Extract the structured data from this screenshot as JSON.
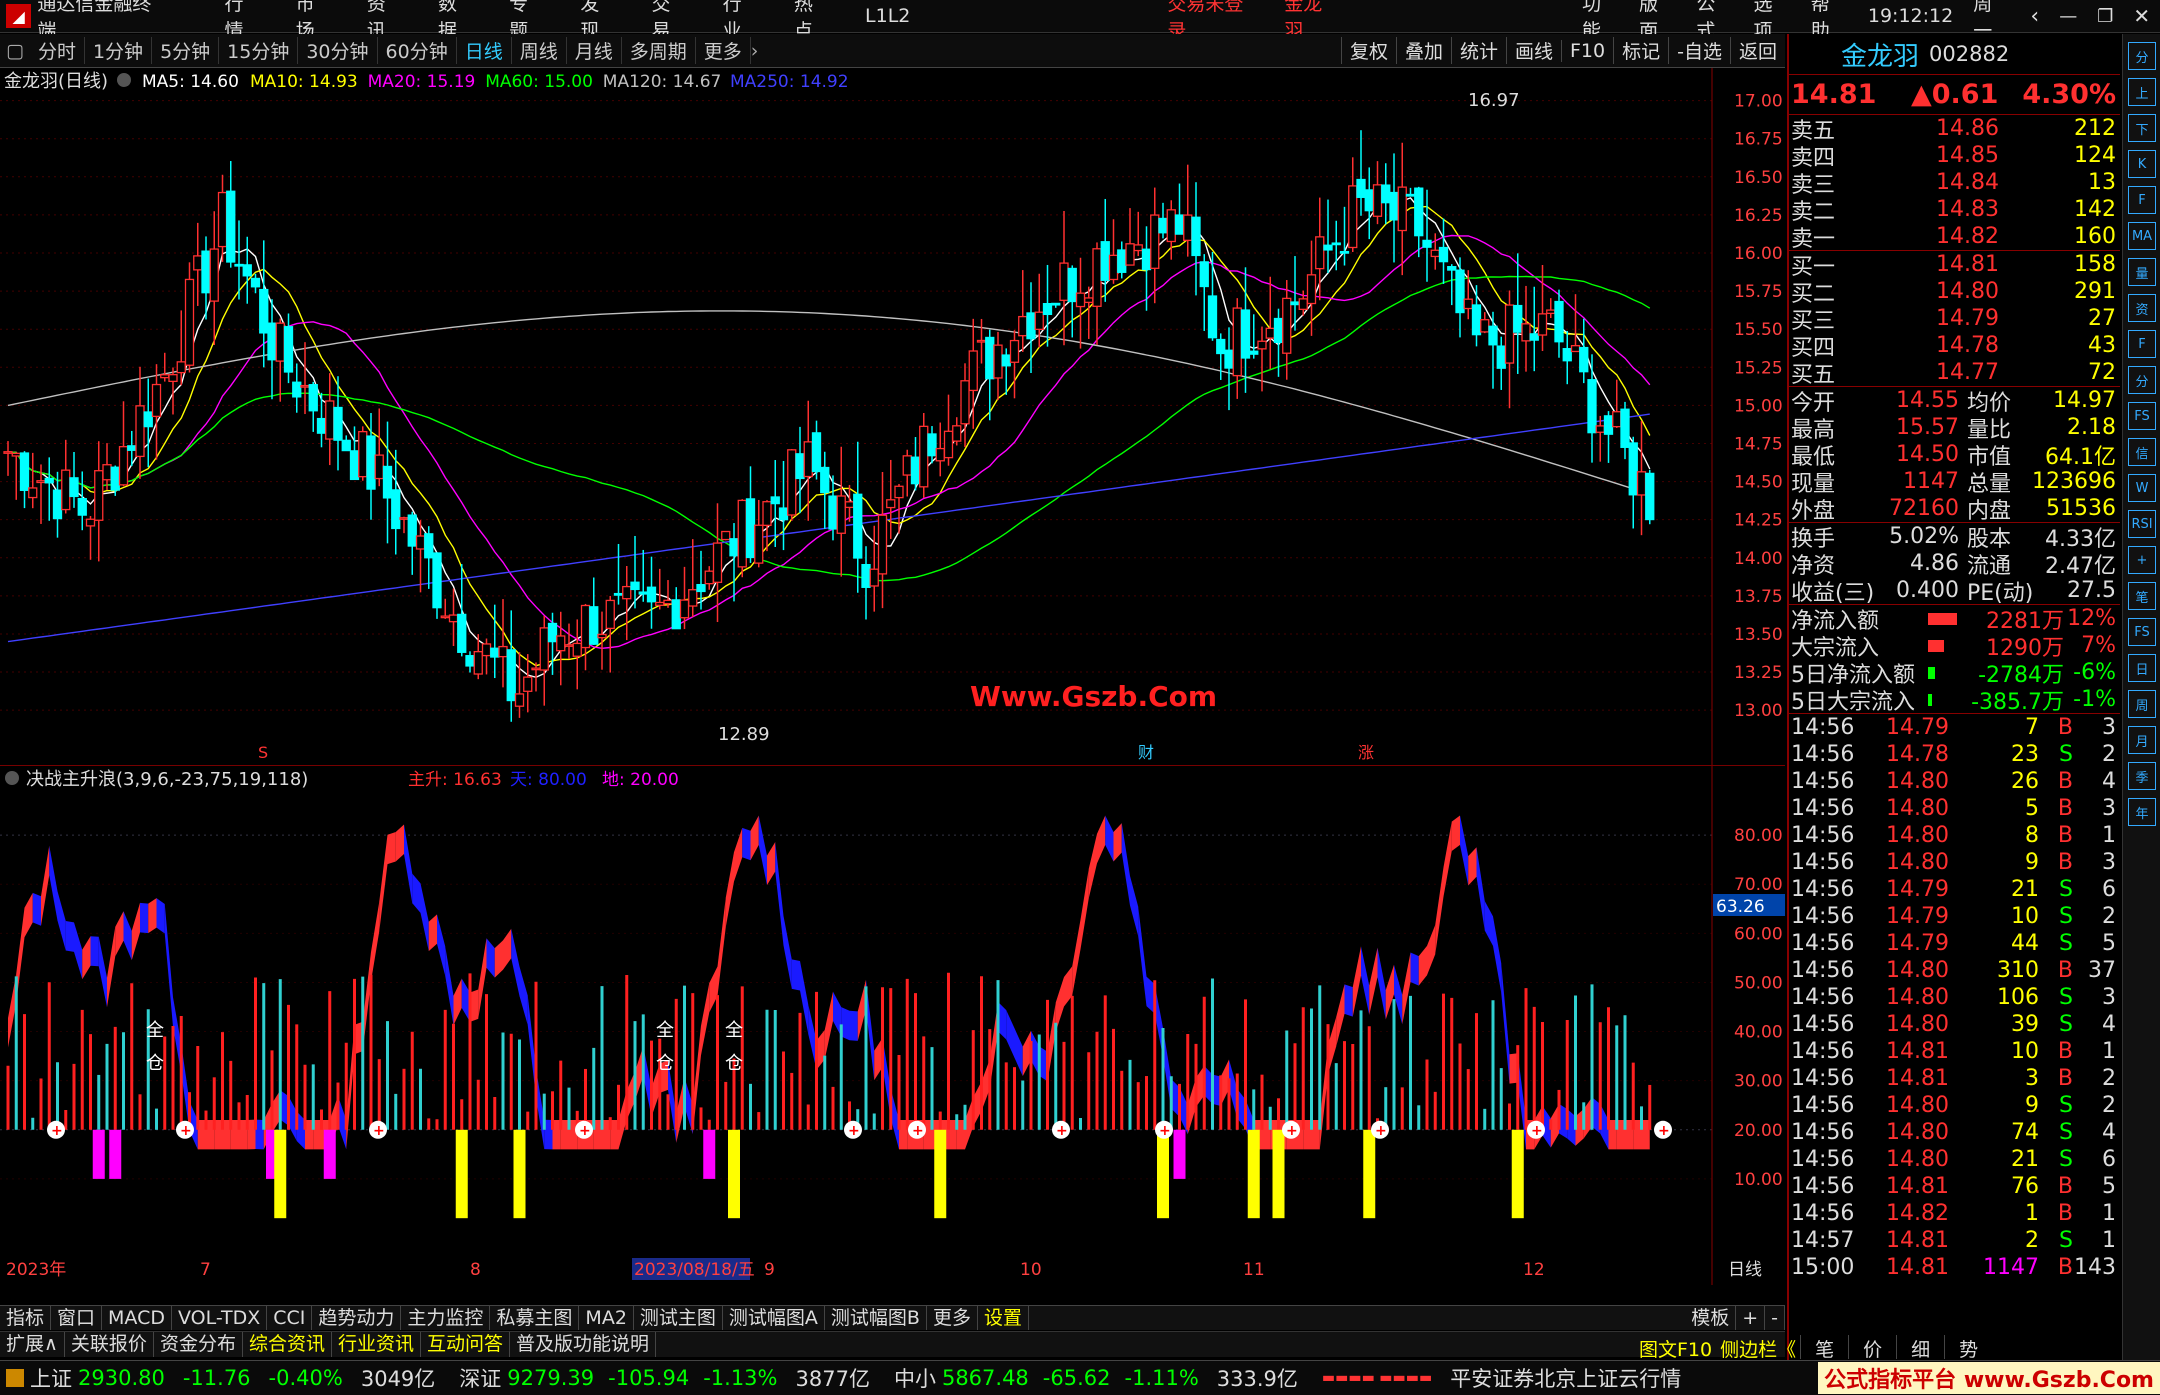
{
  "menubar": {
    "app_name": "通达信金融终端",
    "items": [
      "行情",
      "市场",
      "资讯",
      "数据",
      "专题",
      "发现",
      "交易",
      "行业",
      "热点",
      "L1L2"
    ],
    "login_status": "交易未登录",
    "stock_name": "金龙羽",
    "right_items": [
      "功能",
      "版面",
      "公式",
      "选项",
      "帮助"
    ],
    "time": "19:12:12",
    "weekday": "周一"
  },
  "toolbar": {
    "periods": [
      "分时",
      "1分钟",
      "5分钟",
      "15分钟",
      "30分钟",
      "60分钟",
      "日线",
      "周线",
      "月线",
      "多周期",
      "更多"
    ],
    "active_period": "日线",
    "tools": [
      "复权",
      "叠加",
      "统计",
      "画线",
      "F10",
      "标记",
      "-自选",
      "返回"
    ]
  },
  "main_chart": {
    "title": "金龙羽(日线)",
    "ma_labels": [
      {
        "text": "MA5: 14.60",
        "color": "#ffffff"
      },
      {
        "text": "MA10: 14.93",
        "color": "#ffff00"
      },
      {
        "text": "MA20: 15.19",
        "color": "#ff00ff"
      },
      {
        "text": "MA60: 15.00",
        "color": "#00ff00"
      },
      {
        "text": "MA120: 14.67",
        "color": "#c0c0c0"
      },
      {
        "text": "MA250: 14.92",
        "color": "#4040ff"
      }
    ],
    "high_label": "16.97",
    "low_label": "12.89",
    "watermark": "Www.Gszb.Com",
    "markers": [
      "S",
      "财",
      "涨"
    ]
  },
  "chart_data": [
    {
      "type": "candlestick",
      "title": "金龙羽(日线)",
      "ylim": [
        12.85,
        17.05
      ],
      "y_ticks": [
        17.0,
        16.75,
        16.5,
        16.25,
        16.0,
        15.75,
        15.5,
        15.25,
        15.0,
        14.75,
        14.5,
        14.25,
        14.0,
        13.75,
        13.5,
        13.25,
        13.0
      ],
      "x_tick_labels": [
        "2023年",
        "7",
        "8",
        "2023/08/18/五",
        "9",
        "10",
        "11",
        "12"
      ],
      "high": 16.97,
      "low": 12.89
    },
    {
      "type": "area",
      "title": "决战主升浪(3,9,6,-23,75,19,118)",
      "ylim": [
        0,
        90
      ],
      "y_ticks": [
        80.0,
        70.0,
        60.0,
        50.0,
        40.0,
        30.0,
        20.0,
        10.0
      ],
      "current_value": "63.26",
      "series_labels": [
        {
          "text": "主升: 16.63",
          "color": "#ff3030"
        },
        {
          "text": "天: 80.00",
          "color": "#2020ff"
        },
        {
          "text": "地: 20.00",
          "color": "#ff00ff"
        }
      ]
    }
  ],
  "indicator": {
    "title": "决战主升浪(3,9,6,-23,75,19,118)",
    "current": "63.26",
    "signals": [
      "全仓",
      "全仓",
      "全仓"
    ]
  },
  "x_axis": {
    "labels": [
      "2023年",
      "7",
      "8",
      "2023/08/18/五",
      "9",
      "10",
      "11",
      "12"
    ],
    "period": "日线"
  },
  "bottom_tabs": [
    "指标",
    "窗口",
    "MACD",
    "VOL-TDX",
    "CCI",
    "趋势动力",
    "主力监控",
    "私募主图",
    "MA2",
    "测试主图",
    "测试幅图A",
    "测试幅图B",
    "更多",
    "设置"
  ],
  "bottom_tabs_right": [
    "模板",
    "+",
    "-"
  ],
  "bottom_tabs2": [
    "扩展∧",
    "关联报价",
    "资金分布",
    "综合资讯",
    "行业资讯",
    "互动问答",
    "普及版功能说明"
  ],
  "bottom_tabs2_highlight": [
    "综合资讯",
    "行业资讯",
    "互动问答"
  ],
  "side_tabs": [
    "图文F10",
    "侧边栏《",
    "笔",
    "价",
    "细",
    "势"
  ],
  "quote": {
    "name": "金龙羽",
    "code": "002882",
    "price": "14.81",
    "change": "▲0.61",
    "pct": "4.30%",
    "asks": [
      {
        "label": "卖五",
        "price": "14.86",
        "vol": "212"
      },
      {
        "label": "卖四",
        "price": "14.85",
        "vol": "124"
      },
      {
        "label": "卖三",
        "price": "14.84",
        "vol": "13"
      },
      {
        "label": "卖二",
        "price": "14.83",
        "vol": "142"
      },
      {
        "label": "卖一",
        "price": "14.82",
        "vol": "160"
      }
    ],
    "bids": [
      {
        "label": "买一",
        "price": "14.81",
        "vol": "158"
      },
      {
        "label": "买二",
        "price": "14.80",
        "vol": "291"
      },
      {
        "label": "买三",
        "price": "14.79",
        "vol": "27"
      },
      {
        "label": "买四",
        "price": "14.78",
        "vol": "43"
      },
      {
        "label": "买五",
        "price": "14.77",
        "vol": "72"
      }
    ],
    "stats": [
      [
        "今开",
        "14.55",
        "均价",
        "14.97"
      ],
      [
        "最高",
        "15.57",
        "量比",
        "2.18"
      ],
      [
        "最低",
        "14.50",
        "市值",
        "64.1亿"
      ],
      [
        "现量",
        "1147",
        "总量",
        "123696"
      ],
      [
        "外盘",
        "72160",
        "内盘",
        "51536"
      ]
    ],
    "stats2": [
      [
        "换手",
        "5.02%",
        "股本",
        "4.33亿"
      ],
      [
        "净资",
        "4.86",
        "流通",
        "2.47亿"
      ],
      [
        "收益(三)",
        "0.400",
        "PE(动)",
        "27.5"
      ]
    ],
    "flows": [
      {
        "label": "净流入额",
        "val": "2281万",
        "pct": "12%",
        "color": "#ff3030",
        "bar": 0.9
      },
      {
        "label": "大宗流入",
        "val": "1290万",
        "pct": "7%",
        "color": "#ff3030",
        "bar": 0.45
      },
      {
        "label": "5日净流入额",
        "val": "-2784万",
        "pct": "-6%",
        "color": "#00ff00",
        "bar": 0.18
      },
      {
        "label": "5日大宗流入",
        "val": "-385.7万",
        "pct": "-1%",
        "color": "#00ff00",
        "bar": 0.05
      }
    ],
    "ticks": [
      [
        "14:56",
        "14.79",
        "7",
        "B",
        "3"
      ],
      [
        "14:56",
        "14.78",
        "23",
        "S",
        "2"
      ],
      [
        "14:56",
        "14.80",
        "26",
        "B",
        "4"
      ],
      [
        "14:56",
        "14.80",
        "5",
        "B",
        "3"
      ],
      [
        "14:56",
        "14.80",
        "8",
        "B",
        "1"
      ],
      [
        "14:56",
        "14.80",
        "9",
        "B",
        "3"
      ],
      [
        "14:56",
        "14.79",
        "21",
        "S",
        "6"
      ],
      [
        "14:56",
        "14.79",
        "10",
        "S",
        "2"
      ],
      [
        "14:56",
        "14.79",
        "44",
        "S",
        "5"
      ],
      [
        "14:56",
        "14.80",
        "310",
        "B",
        "37"
      ],
      [
        "14:56",
        "14.80",
        "106",
        "S",
        "3"
      ],
      [
        "14:56",
        "14.80",
        "39",
        "S",
        "4"
      ],
      [
        "14:56",
        "14.81",
        "10",
        "B",
        "1"
      ],
      [
        "14:56",
        "14.81",
        "3",
        "B",
        "2"
      ],
      [
        "14:56",
        "14.80",
        "9",
        "S",
        "2"
      ],
      [
        "14:56",
        "14.80",
        "74",
        "S",
        "4"
      ],
      [
        "14:56",
        "14.80",
        "21",
        "S",
        "6"
      ],
      [
        "14:56",
        "14.81",
        "76",
        "B",
        "5"
      ],
      [
        "14:56",
        "14.82",
        "1",
        "B",
        "1"
      ],
      [
        "14:57",
        "14.81",
        "2",
        "S",
        "1"
      ],
      [
        "15:00",
        "14.81",
        "1147",
        "B",
        "143"
      ]
    ]
  },
  "status": {
    "sh_label": "上证",
    "sh_val": "2930.80",
    "sh_chg": "-11.76",
    "sh_pct": "-0.40%",
    "sh_amt": "3049亿",
    "sz_label": "深证",
    "sz_val": "9279.39",
    "sz_chg": "-105.94",
    "sz_pct": "-1.13%",
    "sz_amt": "3877亿",
    "zx_label": "中小",
    "zx_val": "5867.48",
    "zx_chg": "-65.62",
    "zx_pct": "-1.11%",
    "zx_amt": "333.9亿",
    "broker": "平安证券北京上证云行情",
    "watermark": "公式指标平台 www.Gszb.Com"
  },
  "right_icons": [
    "分",
    "上",
    "下",
    "K",
    "F",
    "MA",
    "量",
    "资",
    "F",
    "分",
    "FS",
    "信",
    "W",
    "RSI",
    "+",
    "笔",
    "FS",
    "日",
    "周",
    "月",
    "季",
    "年"
  ]
}
